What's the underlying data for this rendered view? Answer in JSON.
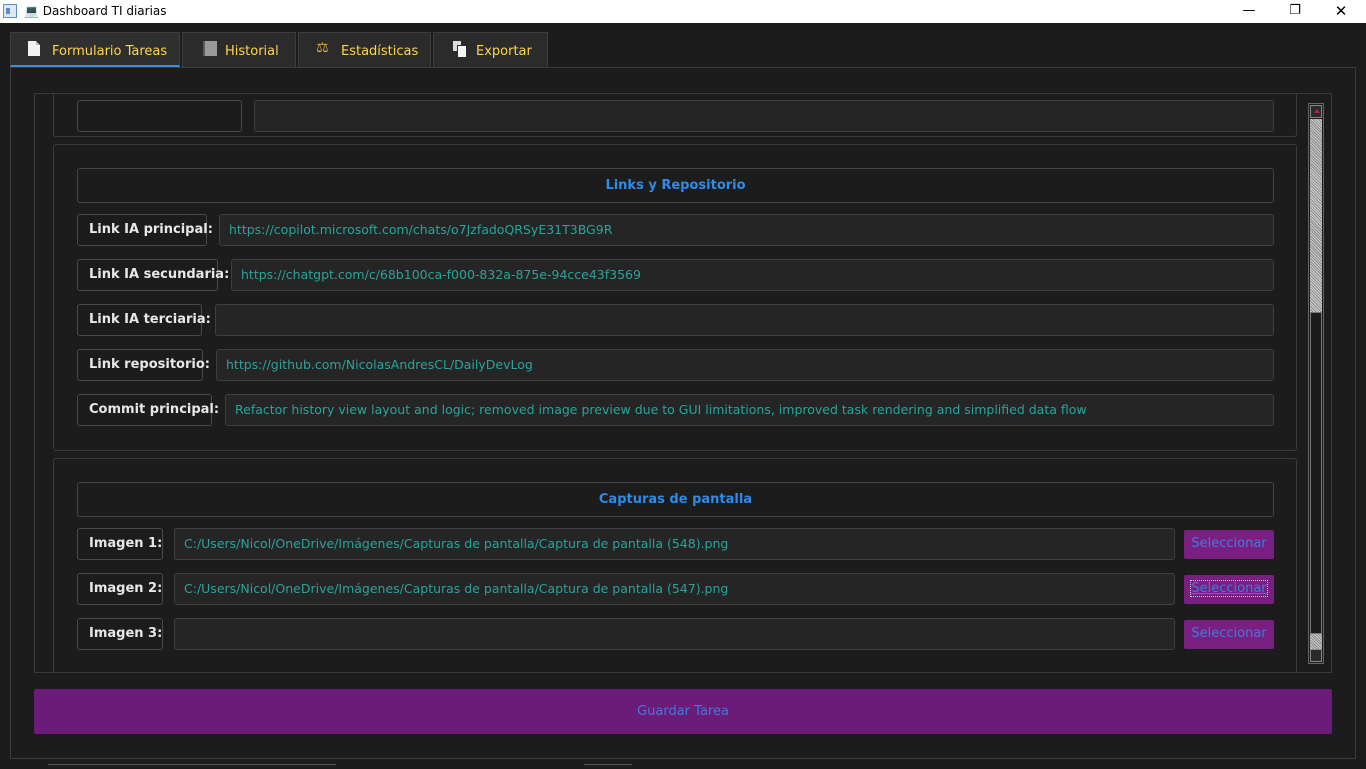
{
  "window": {
    "title": "💻 Dashboard TI diarias",
    "minimize": "—",
    "maximize": "❐",
    "close": "✕"
  },
  "tabs": [
    {
      "label": "Formulario Tareas",
      "icon": "document-icon",
      "active": true
    },
    {
      "label": "Historial",
      "icon": "book-icon",
      "active": false
    },
    {
      "label": "Estadísticas",
      "icon": "scale-icon",
      "active": false
    },
    {
      "label": "Exportar",
      "icon": "copy-icon",
      "active": false
    }
  ],
  "links_section": {
    "header": "Links y Repositorio",
    "rows": [
      {
        "label": "Link IA principal:",
        "value": "https://copilot.microsoft.com/chats/o7JzfadoQRSyE31T3BG9R"
      },
      {
        "label": "Link IA secundaria:",
        "value": "https://chatgpt.com/c/68b100ca-f000-832a-875e-94cce43f3569"
      },
      {
        "label": "Link IA terciaria:",
        "value": ""
      },
      {
        "label": "Link repositorio:",
        "value": "https://github.com/NicolasAndresCL/DailyDevLog"
      },
      {
        "label": "Commit principal:",
        "value": "Refactor history view layout and logic; removed image preview due to GUI limitations, improved task rendering and simplified data flow"
      }
    ]
  },
  "captures_section": {
    "header": "Capturas de pantalla",
    "rows": [
      {
        "label": "Imagen 1:",
        "value": "C:/Users/Nicol/OneDrive/Imágenes/Capturas de pantalla/Captura de pantalla (548).png",
        "button": "Seleccionar"
      },
      {
        "label": "Imagen 2:",
        "value": "C:/Users/Nicol/OneDrive/Imágenes/Capturas de pantalla/Captura de pantalla (547).png",
        "button": "Seleccionar"
      },
      {
        "label": "Imagen 3:",
        "value": "",
        "button": "Seleccionar"
      }
    ]
  },
  "save_button": "Guardar Tarea",
  "colors": {
    "accent_blue": "#2e8be8",
    "field_text": "#2aa39a",
    "button_purple": "#7a1f82",
    "tab_text": "#ffd54a"
  }
}
